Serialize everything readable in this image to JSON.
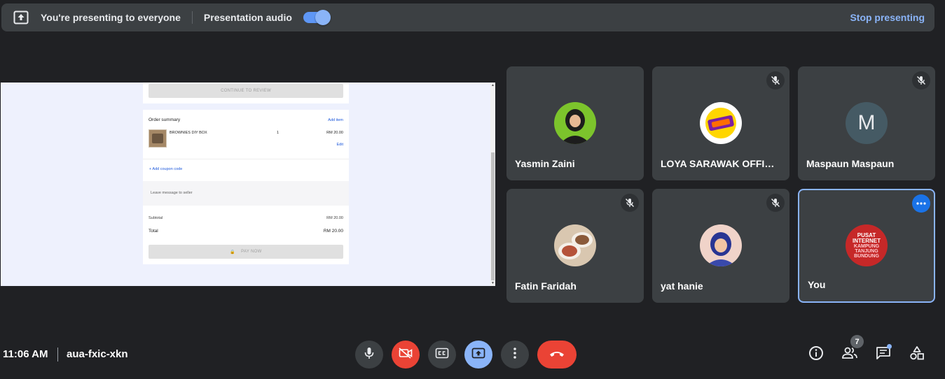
{
  "topbar": {
    "message": "You're presenting to everyone",
    "audio_label": "Presentation audio",
    "audio_enabled": true,
    "stop_label": "Stop presenting"
  },
  "shared_screen": {
    "continue_button": "CONTINUE TO REVIEW",
    "order_summary_title": "Order summary",
    "add_item": "Add item",
    "item": {
      "name": "BROWNIES DIY BOX",
      "qty": "1",
      "price": "RM 20.00",
      "edit": "Edit"
    },
    "coupon": "+ Add coupon code",
    "leave_message": "Leave message to seller",
    "subtotal_label": "Subtotal",
    "subtotal_value": "RM 20.00",
    "total_label": "Total",
    "total_value": "RM 20.00",
    "pay_button": "PAY NOW"
  },
  "participants": [
    {
      "name": "Yasmin Zaini",
      "muted": false
    },
    {
      "name": "LOYA SARAWAK OFFICI…",
      "muted": true
    },
    {
      "name": "Maspaun Maspaun",
      "initial": "M",
      "muted": true
    },
    {
      "name": "Fatin Faridah",
      "muted": true
    },
    {
      "name": "yat hanie",
      "muted": true
    },
    {
      "name": "You",
      "muted": false,
      "avatar_text": [
        "PUSAT",
        "INTERNET",
        "KAMPUNG",
        "TANJUNG",
        "BUNDUNG"
      ]
    }
  ],
  "bottombar": {
    "time": "11:06 AM",
    "meeting_code": "aua-fxic-xkn",
    "participant_count": "7"
  },
  "colors": {
    "background": "#202124",
    "tile": "#3c4043",
    "accent_blue": "#8ab4f8",
    "danger_red": "#ea4335"
  }
}
